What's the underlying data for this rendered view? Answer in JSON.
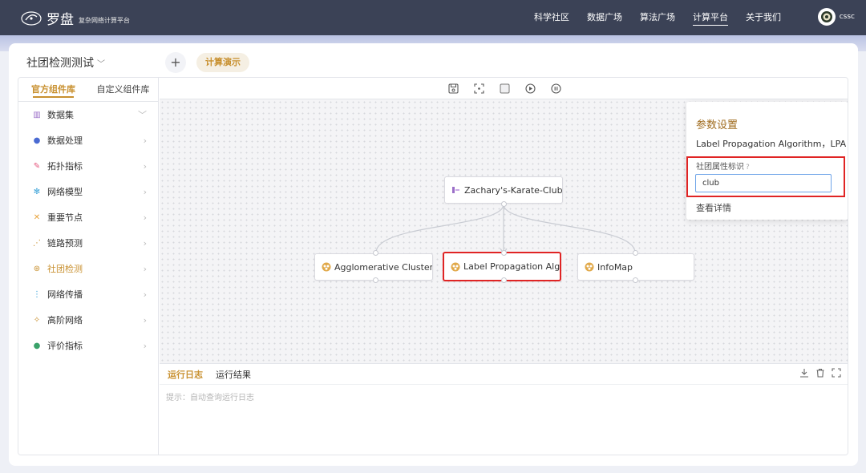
{
  "brand": {
    "title": "罗盘",
    "subtitle": "复杂网络计算平台"
  },
  "nav": {
    "items": [
      "科学社区",
      "数据广场",
      "算法广场",
      "计算平台",
      "关于我们"
    ],
    "active_index": 3
  },
  "user": {
    "name": "cssc"
  },
  "project": {
    "name": "社团检测测试",
    "add_label": "+",
    "demo_label": "计算演示"
  },
  "sidebar": {
    "tabs": [
      "官方组件库",
      "自定义组件库"
    ],
    "items": [
      {
        "label": "数据集",
        "icon": "database-icon",
        "color": "#9b6fc8",
        "arrow": "﹀"
      },
      {
        "label": "数据处理",
        "icon": "globe-icon",
        "color": "#4a6ad2",
        "arrow": "›"
      },
      {
        "label": "拓扑指标",
        "icon": "link-icon",
        "color": "#e4527a",
        "arrow": "›"
      },
      {
        "label": "网络模型",
        "icon": "gear-icon",
        "color": "#3aa2d8",
        "arrow": "›"
      },
      {
        "label": "重要节点",
        "icon": "cross-icon",
        "color": "#e8a23a",
        "arrow": "›"
      },
      {
        "label": "链路预测",
        "icon": "dots-icon",
        "color": "#c8902f",
        "arrow": "›"
      },
      {
        "label": "社团检测",
        "icon": "community-icon",
        "color": "#c8902f",
        "arrow": "›"
      },
      {
        "label": "网络传播",
        "icon": "spread-icon",
        "color": "#3aa2d8",
        "arrow": "›"
      },
      {
        "label": "高阶网络",
        "icon": "hyper-icon",
        "color": "#c8902f",
        "arrow": "›"
      },
      {
        "label": "评价指标",
        "icon": "metric-icon",
        "color": "#3aa26a",
        "arrow": "›"
      }
    ],
    "active_index": 6
  },
  "graph": {
    "nodes": [
      {
        "label": "Zachary's-Karate-Club"
      },
      {
        "label": "Agglomerative Clustering"
      },
      {
        "label": "Label Propagation Algorithm"
      },
      {
        "label": "InfoMap"
      }
    ]
  },
  "panel": {
    "title": "参数设置",
    "algorithm": "Label Propagation Algorithm，LPA",
    "field_label": "社团属性标识",
    "help_icon": "?",
    "field_value": "club",
    "detail_link": "查看详情"
  },
  "log": {
    "tabs": [
      "运行日志",
      "运行结果"
    ],
    "hint": "提示：自动查询运行日志"
  },
  "colors": {
    "accent": "#c8902f",
    "nav_bg": "#3b4256",
    "highlight": "#e02424"
  }
}
